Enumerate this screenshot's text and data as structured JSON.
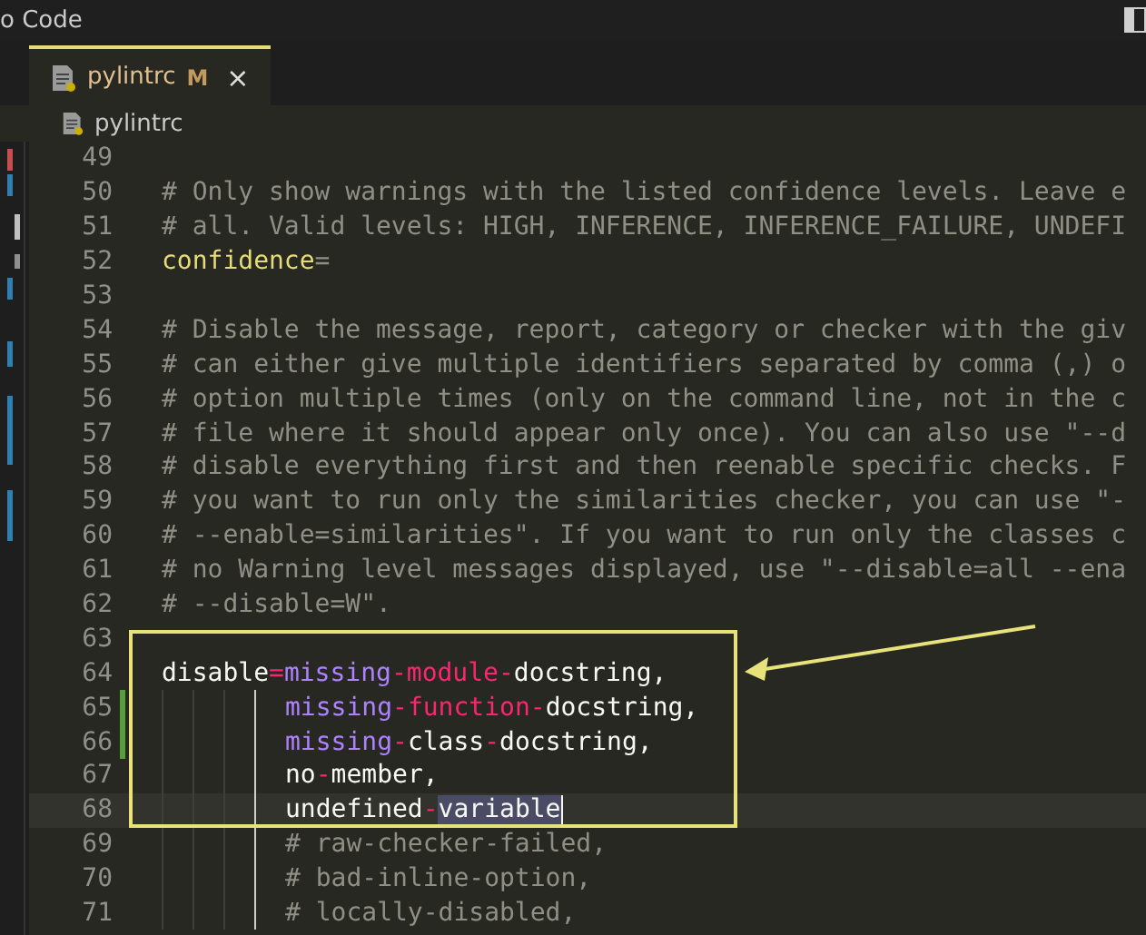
{
  "window": {
    "title": "o Code"
  },
  "tabs": [
    {
      "label": "pylintrc",
      "badge": "M",
      "close": "×",
      "selected": true
    }
  ],
  "breadcrumb": [
    {
      "label": "pylintrc"
    }
  ],
  "editor": {
    "lines": [
      {
        "number": "49"
      },
      {
        "number": "50",
        "tokens": [
          {
            "text": "# Only show warnings with the listed confidence levels. Leave e",
            "kind": "comment"
          }
        ]
      },
      {
        "number": "51",
        "tokens": [
          {
            "text": "# all. Valid levels: HIGH, INFERENCE, INFERENCE_FAILURE, UNDEFI",
            "kind": "comment"
          }
        ]
      },
      {
        "number": "52",
        "tokens": [
          {
            "text": "confidence",
            "kind": "key"
          },
          {
            "text": "=",
            "kind": "op"
          }
        ]
      },
      {
        "number": "53"
      },
      {
        "number": "54",
        "tokens": [
          {
            "text": "# Disable the message, report, category or checker with the giv",
            "kind": "comment"
          }
        ]
      },
      {
        "number": "55",
        "tokens": [
          {
            "text": "# can either give multiple identifiers separated by comma (,) o",
            "kind": "comment"
          }
        ]
      },
      {
        "number": "56",
        "tokens": [
          {
            "text": "# option multiple times (only on the command line, not in the c",
            "kind": "comment"
          }
        ]
      },
      {
        "number": "57",
        "tokens": [
          {
            "text": "# file where it should appear only once). You can also use \"--d",
            "kind": "comment"
          }
        ]
      },
      {
        "number": "58",
        "tokens": [
          {
            "text": "# disable everything first and then reenable specific checks. F",
            "kind": "comment"
          }
        ]
      },
      {
        "number": "59",
        "tokens": [
          {
            "text": "# you want to run only the similarities checker, you can use \"-",
            "kind": "comment"
          }
        ]
      },
      {
        "number": "60",
        "tokens": [
          {
            "text": "# --enable=similarities\". If you want to run only the classes c",
            "kind": "comment"
          }
        ]
      },
      {
        "number": "61",
        "tokens": [
          {
            "text": "# no Warning level messages displayed, use \"--disable=all --ena",
            "kind": "comment"
          }
        ]
      },
      {
        "number": "62",
        "tokens": [
          {
            "text": "# --disable=W\".",
            "kind": "comment"
          }
        ]
      },
      {
        "number": "63"
      },
      {
        "number": "64",
        "tokens": [
          {
            "text": "disable",
            "kind": "plain"
          },
          {
            "text": "=",
            "kind": "accent"
          },
          {
            "text": "missing",
            "kind": "value"
          },
          {
            "text": "-module-",
            "kind": "accent"
          },
          {
            "text": "docstring,",
            "kind": "plain"
          }
        ]
      },
      {
        "number": "65",
        "indented": true,
        "modified": true,
        "tokens": [
          {
            "text": "missing",
            "kind": "value"
          },
          {
            "text": "-function-",
            "kind": "accent"
          },
          {
            "text": "docstring,",
            "kind": "plain"
          }
        ]
      },
      {
        "number": "66",
        "indented": true,
        "modified": true,
        "tokens": [
          {
            "text": "missing",
            "kind": "value"
          },
          {
            "text": "-",
            "kind": "accent"
          },
          {
            "text": "class",
            "kind": "plain"
          },
          {
            "text": "-",
            "kind": "accent"
          },
          {
            "text": "docstring,",
            "kind": "plain"
          }
        ]
      },
      {
        "number": "67",
        "indented": true,
        "tokens": [
          {
            "text": "no",
            "kind": "plain"
          },
          {
            "text": "-",
            "kind": "accent"
          },
          {
            "text": "member,",
            "kind": "plain"
          }
        ]
      },
      {
        "number": "68",
        "indented": true,
        "current": true,
        "tokens": [
          {
            "text": "undefined",
            "kind": "plain"
          },
          {
            "text": "-",
            "kind": "accent"
          },
          {
            "text": "variable",
            "kind": "plain",
            "selected": true
          }
        ]
      },
      {
        "number": "69",
        "indented": true,
        "tokens": [
          {
            "text": "# raw-checker-failed,",
            "kind": "comment"
          }
        ]
      },
      {
        "number": "70",
        "indented": true,
        "tokens": [
          {
            "text": "# bad-inline-option,",
            "kind": "comment"
          }
        ]
      },
      {
        "number": "71",
        "indented": true,
        "tokens": [
          {
            "text": "# locally-disabled,",
            "kind": "comment"
          }
        ]
      }
    ]
  }
}
